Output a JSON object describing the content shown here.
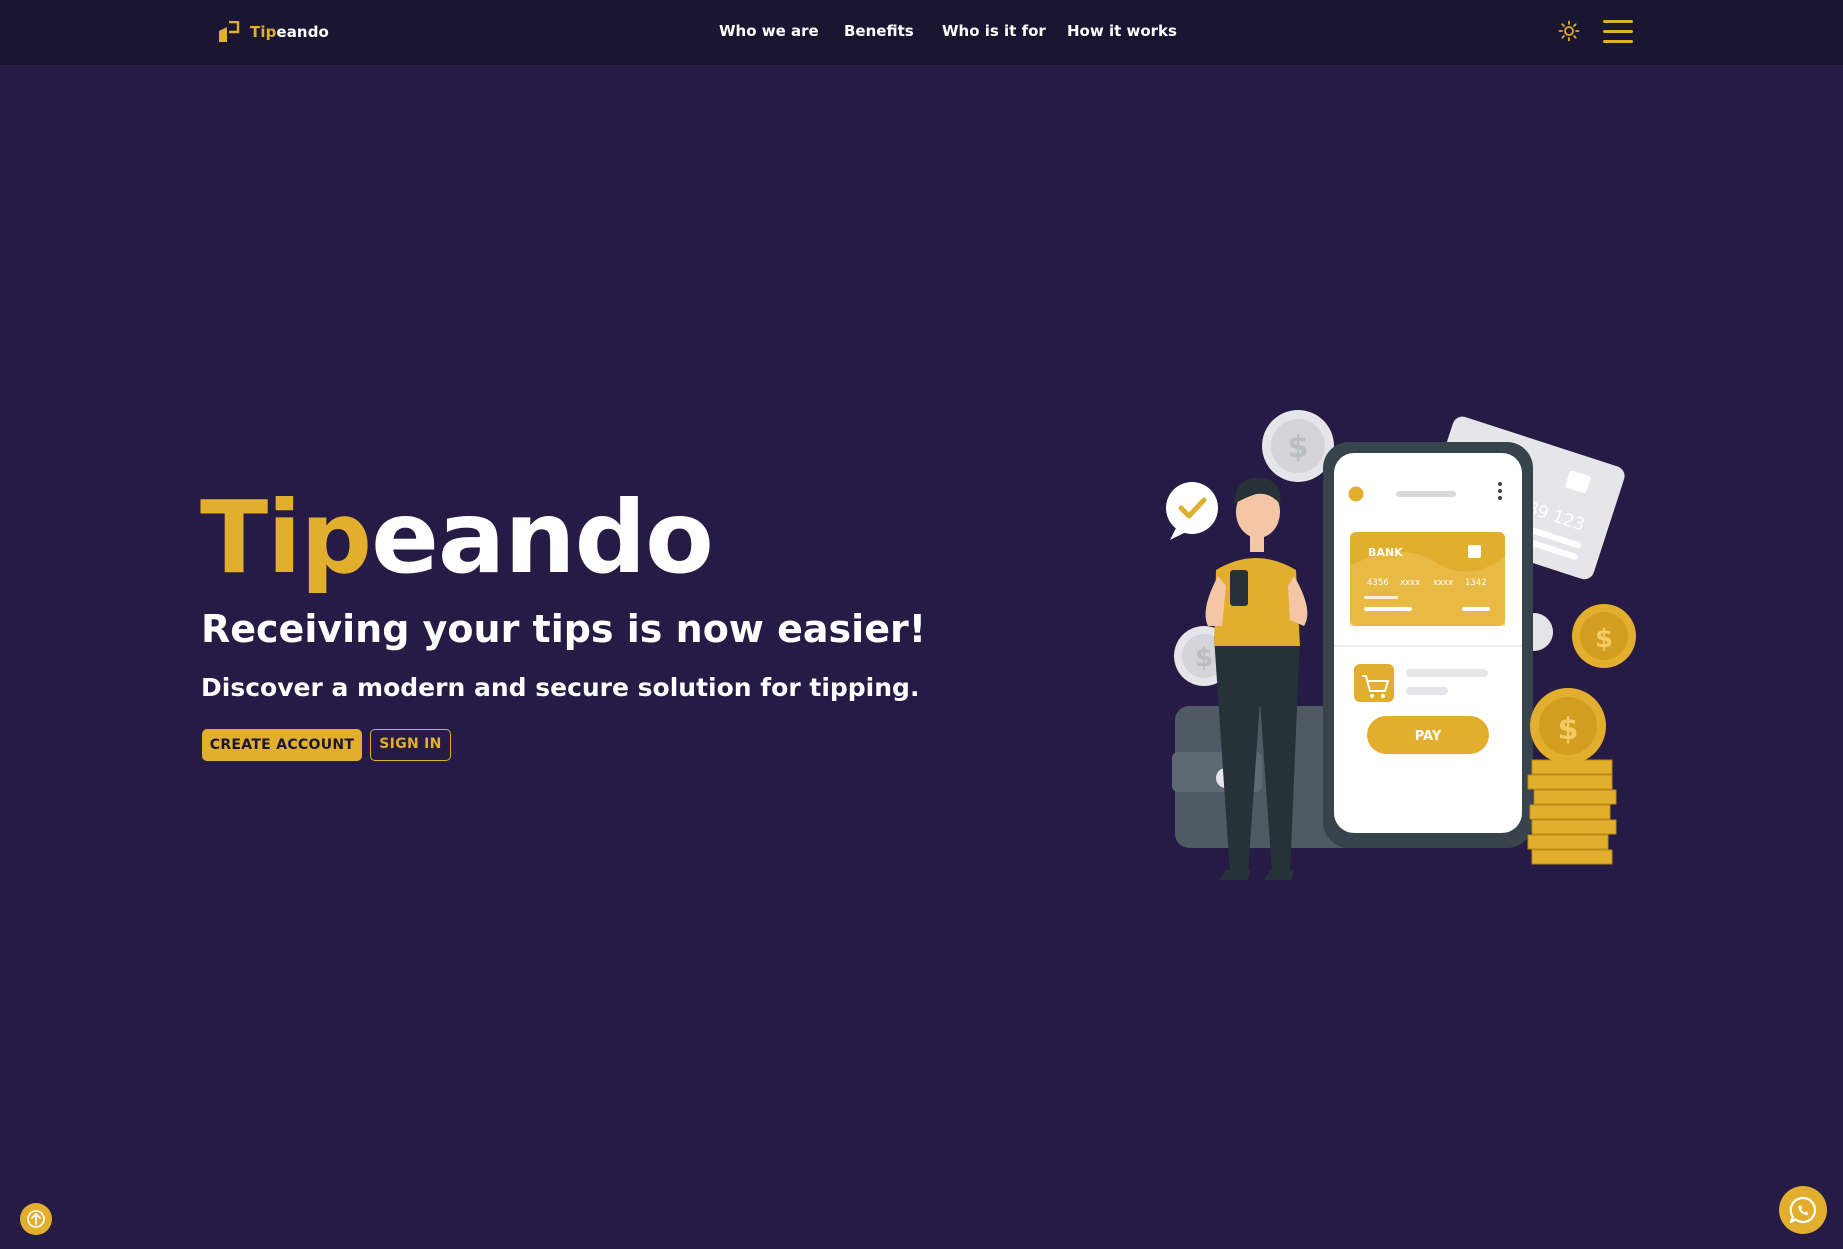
{
  "brand": {
    "name_highlight": "Tip",
    "name_rest": "eando",
    "accent_color": "#e2ae2d",
    "background_color": "#251b45",
    "header_color": "#1a1631"
  },
  "nav": {
    "items": [
      {
        "label": "Who we are"
      },
      {
        "label": "Benefits"
      },
      {
        "label": "Who is it for"
      },
      {
        "label": "How it works"
      }
    ]
  },
  "header_icons": {
    "theme": "sun-icon",
    "menu": "hamburger-menu-icon"
  },
  "hero": {
    "title_highlight": "Tip",
    "title_rest": "eando",
    "subtitle": "Receiving your tips is now easier!",
    "description": "Discover a modern and secure solution for tipping.",
    "primary_button": "CREATE ACCOUNT",
    "secondary_button": "SIGN IN"
  },
  "illustration": {
    "card_bank_label": "BANK",
    "card_number_groups": [
      "4356",
      "xxxx",
      "xxxx",
      "1342"
    ],
    "back_card_number": "789 123",
    "pay_button_label": "PAY",
    "coin_symbol": "$"
  },
  "floating": {
    "back_to_top": "arrow-up-icon",
    "chat": "whatsapp-icon"
  }
}
